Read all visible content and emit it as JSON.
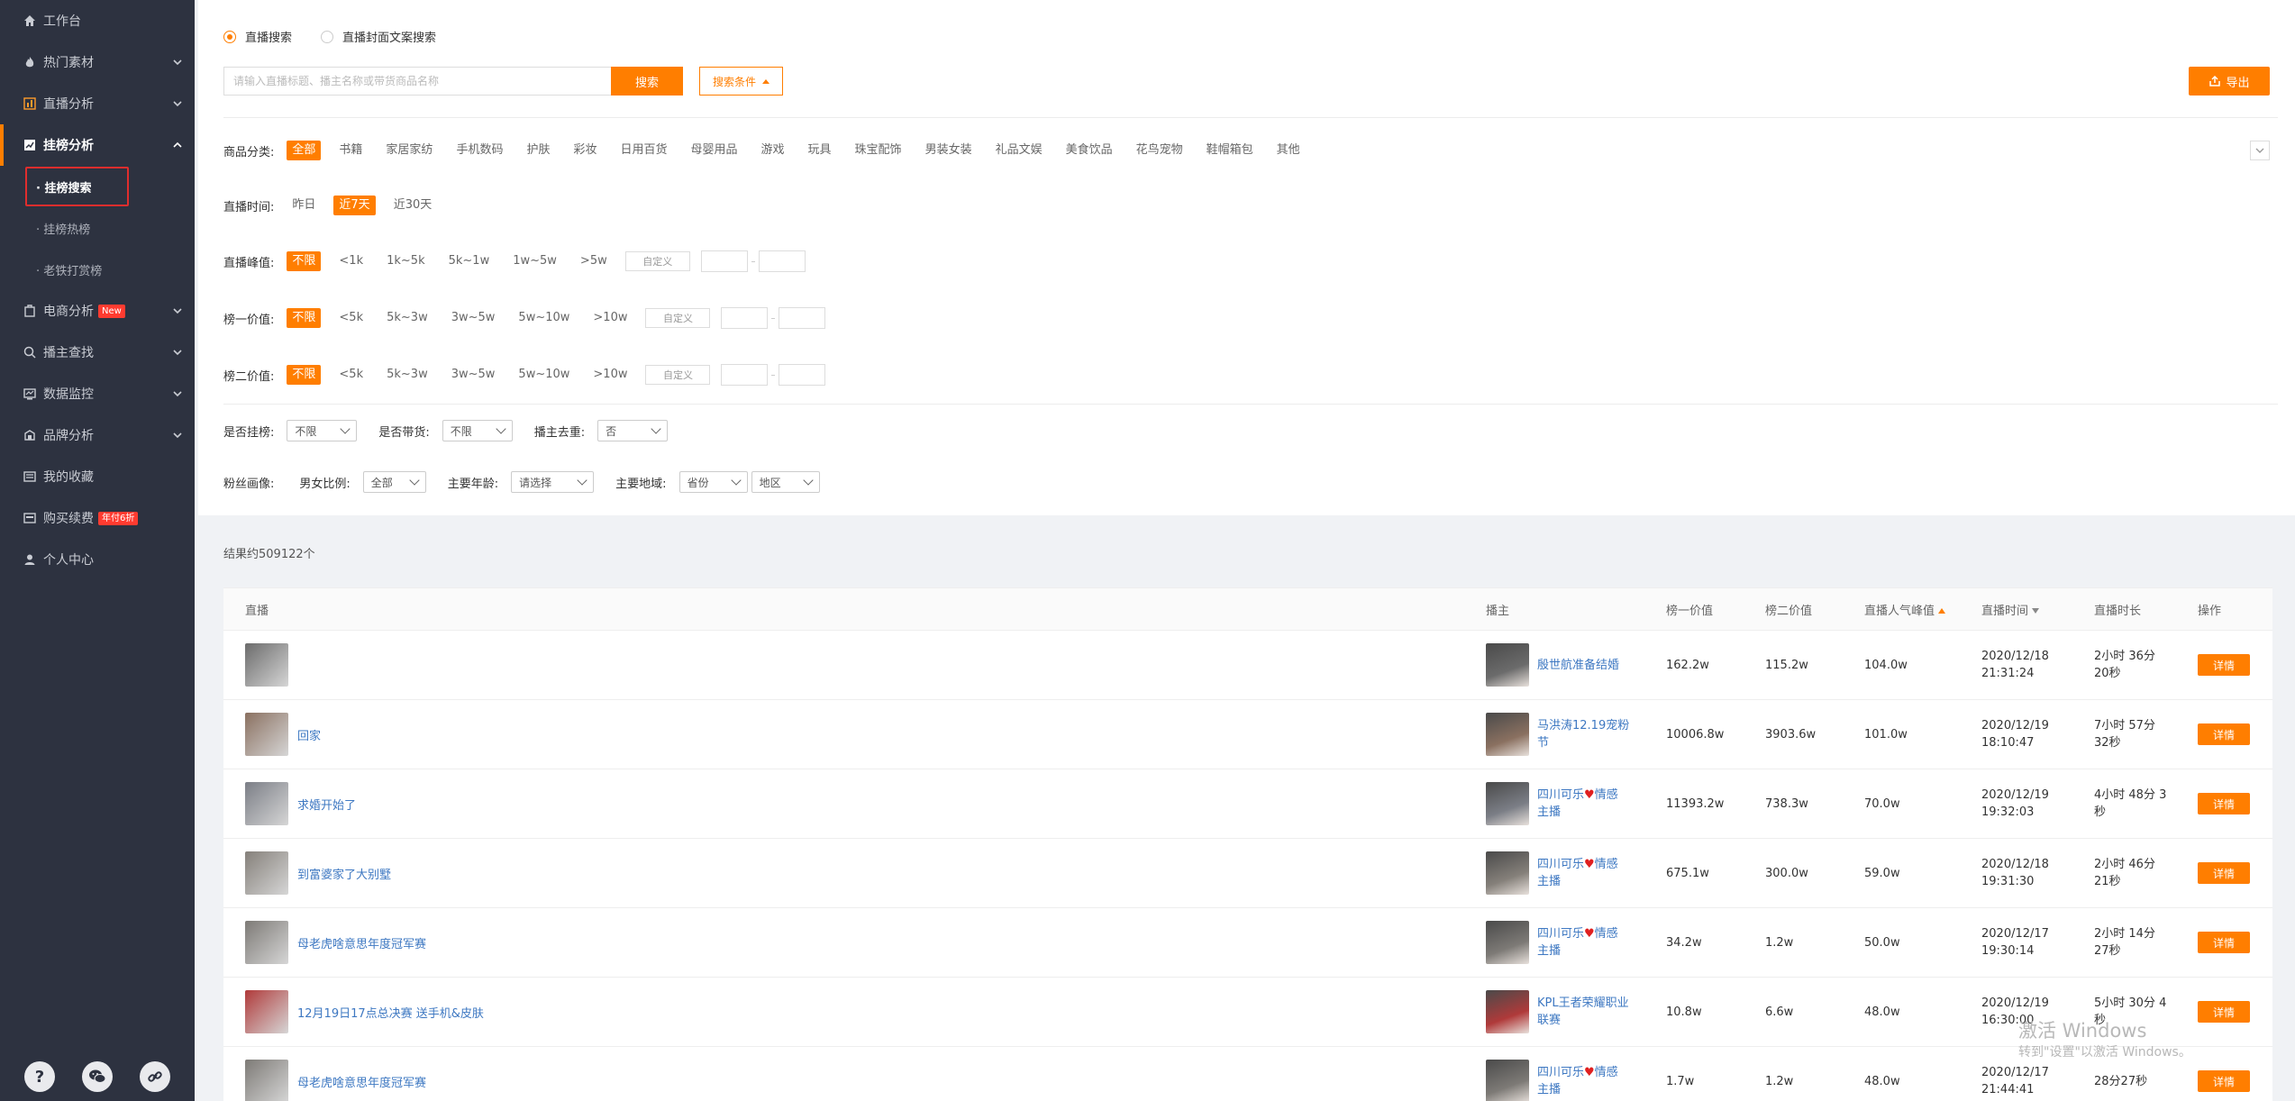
{
  "sidebar": {
    "items": [
      {
        "label": "工作台"
      },
      {
        "label": "热门素材"
      },
      {
        "label": "直播分析"
      },
      {
        "label": "挂榜分析"
      },
      {
        "label": "电商分析",
        "badge": "New"
      },
      {
        "label": "播主查找"
      },
      {
        "label": "数据监控"
      },
      {
        "label": "品牌分析"
      },
      {
        "label": "我的收藏"
      },
      {
        "label": "购买续费",
        "badge": "年付6折"
      },
      {
        "label": "个人中心"
      }
    ],
    "sub_items": [
      {
        "label": "· 挂榜搜索"
      },
      {
        "label": "· 挂榜热榜"
      },
      {
        "label": "· 老铁打赏榜"
      }
    ],
    "bottom": {
      "help": "?",
      "wechat": "wechat-icon",
      "link": "link-icon"
    }
  },
  "search": {
    "radio1": "直播搜索",
    "radio2": "直播封面文案搜索",
    "placeholder": "请输入直播标题、播主名称或带货商品名称",
    "button": "搜索",
    "conditions": "搜索条件",
    "export": "导出"
  },
  "filters": {
    "category": {
      "label": "商品分类:",
      "options": [
        "全部",
        "书籍",
        "家居家纺",
        "手机数码",
        "护肤",
        "彩妆",
        "日用百货",
        "母婴用品",
        "游戏",
        "玩具",
        "珠宝配饰",
        "男装女装",
        "礼品文娱",
        "美食饮品",
        "花鸟宠物",
        "鞋帽箱包",
        "其他"
      ]
    },
    "time": {
      "label": "直播时间:",
      "options": [
        "昨日",
        "近7天",
        "近30天"
      ]
    },
    "peak": {
      "label": "直播峰值:",
      "options": [
        "不限",
        "<1k",
        "1k~5k",
        "5k~1w",
        "1w~5w",
        ">5w"
      ],
      "custom": "自定义"
    },
    "rank1": {
      "label": "榜一价值:",
      "options": [
        "不限",
        "<5k",
        "5k~3w",
        "3w~5w",
        "5w~10w",
        ">10w"
      ],
      "custom": "自定义"
    },
    "rank2": {
      "label": "榜二价值:",
      "options": [
        "不限",
        "<5k",
        "5k~3w",
        "3w~5w",
        "5w~10w",
        ">10w"
      ],
      "custom": "自定义"
    },
    "hang": {
      "label": "是否挂榜:",
      "value": "不限"
    },
    "goods": {
      "label": "是否带货:",
      "value": "不限"
    },
    "dedupe": {
      "label": "播主去重:",
      "value": "否"
    },
    "fans": {
      "label": "粉丝画像:",
      "gender_label": "男女比例:",
      "gender_value": "全部",
      "age_label": "主要年龄:",
      "age_value": "请选择",
      "region_label": "主要地域:",
      "province_value": "省份",
      "city_value": "地区"
    }
  },
  "results": {
    "count": "结果约509122个"
  },
  "table": {
    "headers": {
      "live": "直播",
      "anchor": "播主",
      "v1": "榜一价值",
      "v2": "榜二价值",
      "peak": "直播人气峰值",
      "time": "直播时间",
      "dur": "直播时长",
      "op": "操作"
    },
    "detail_label": "详情",
    "rows": [
      {
        "title": "",
        "anchor1": "殷世航准备结婚",
        "anchor2": "",
        "v1": "162.2w",
        "v2": "115.2w",
        "peak": "104.0w",
        "date": "2020/12/18",
        "clock": "21:31:24",
        "dur1": "2小时 36分",
        "dur2": "20秒",
        "color": "#6b6b6b"
      },
      {
        "title": "回家",
        "anchor1": "马洪涛12.19宠粉",
        "anchor2": "节",
        "v1": "10006.8w",
        "v2": "3903.6w",
        "peak": "101.0w",
        "date": "2020/12/19",
        "clock": "18:10:47",
        "dur1": "7小时 57分",
        "dur2": "32秒",
        "color": "#8a7060"
      },
      {
        "title": "求婚开始了",
        "anchor1": "四川可乐",
        "anchor1b": "情感",
        "anchor2": "主播",
        "v1": "11393.2w",
        "v2": "738.3w",
        "peak": "70.0w",
        "date": "2020/12/19",
        "clock": "19:32:03",
        "dur1": "4小时 48分 3",
        "dur2": "秒",
        "color": "#7b7e86"
      },
      {
        "title": "到富婆家了大别墅",
        "anchor1": "四川可乐",
        "anchor1b": "情感",
        "anchor2": "主播",
        "v1": "675.1w",
        "v2": "300.0w",
        "peak": "59.0w",
        "date": "2020/12/18",
        "clock": "19:31:30",
        "dur1": "2小时 46分",
        "dur2": "21秒",
        "color": "#85807a"
      },
      {
        "title": "母老虎啥意思年度冠军赛",
        "anchor1": "四川可乐",
        "anchor1b": "情感",
        "anchor2": "主播",
        "v1": "34.2w",
        "v2": "1.2w",
        "peak": "50.0w",
        "date": "2020/12/17",
        "clock": "19:30:14",
        "dur1": "2小时 14分",
        "dur2": "27秒",
        "color": "#7d7a76"
      },
      {
        "title": "12月19日17点总决赛 送手机&皮肤",
        "anchor1": "KPL王者荣耀职业",
        "anchor2": "联赛",
        "v1": "10.8w",
        "v2": "6.6w",
        "peak": "48.0w",
        "date": "2020/12/19",
        "clock": "16:30:00",
        "dur1": "5小时 30分 4",
        "dur2": "秒",
        "color": "#b03a3a"
      },
      {
        "title": "母老虎啥意思年度冠军赛",
        "anchor1": "四川可乐",
        "anchor1b": "情感",
        "anchor2": "主播",
        "v1": "1.7w",
        "v2": "1.2w",
        "peak": "48.0w",
        "date": "2020/12/17",
        "clock": "21:44:41",
        "dur1": "28分27秒",
        "dur2": "",
        "color": "#7d7a76"
      }
    ]
  },
  "watermark": {
    "line1": "激活 Windows",
    "line2": "转到\"设置\"以激活 Windows。"
  }
}
